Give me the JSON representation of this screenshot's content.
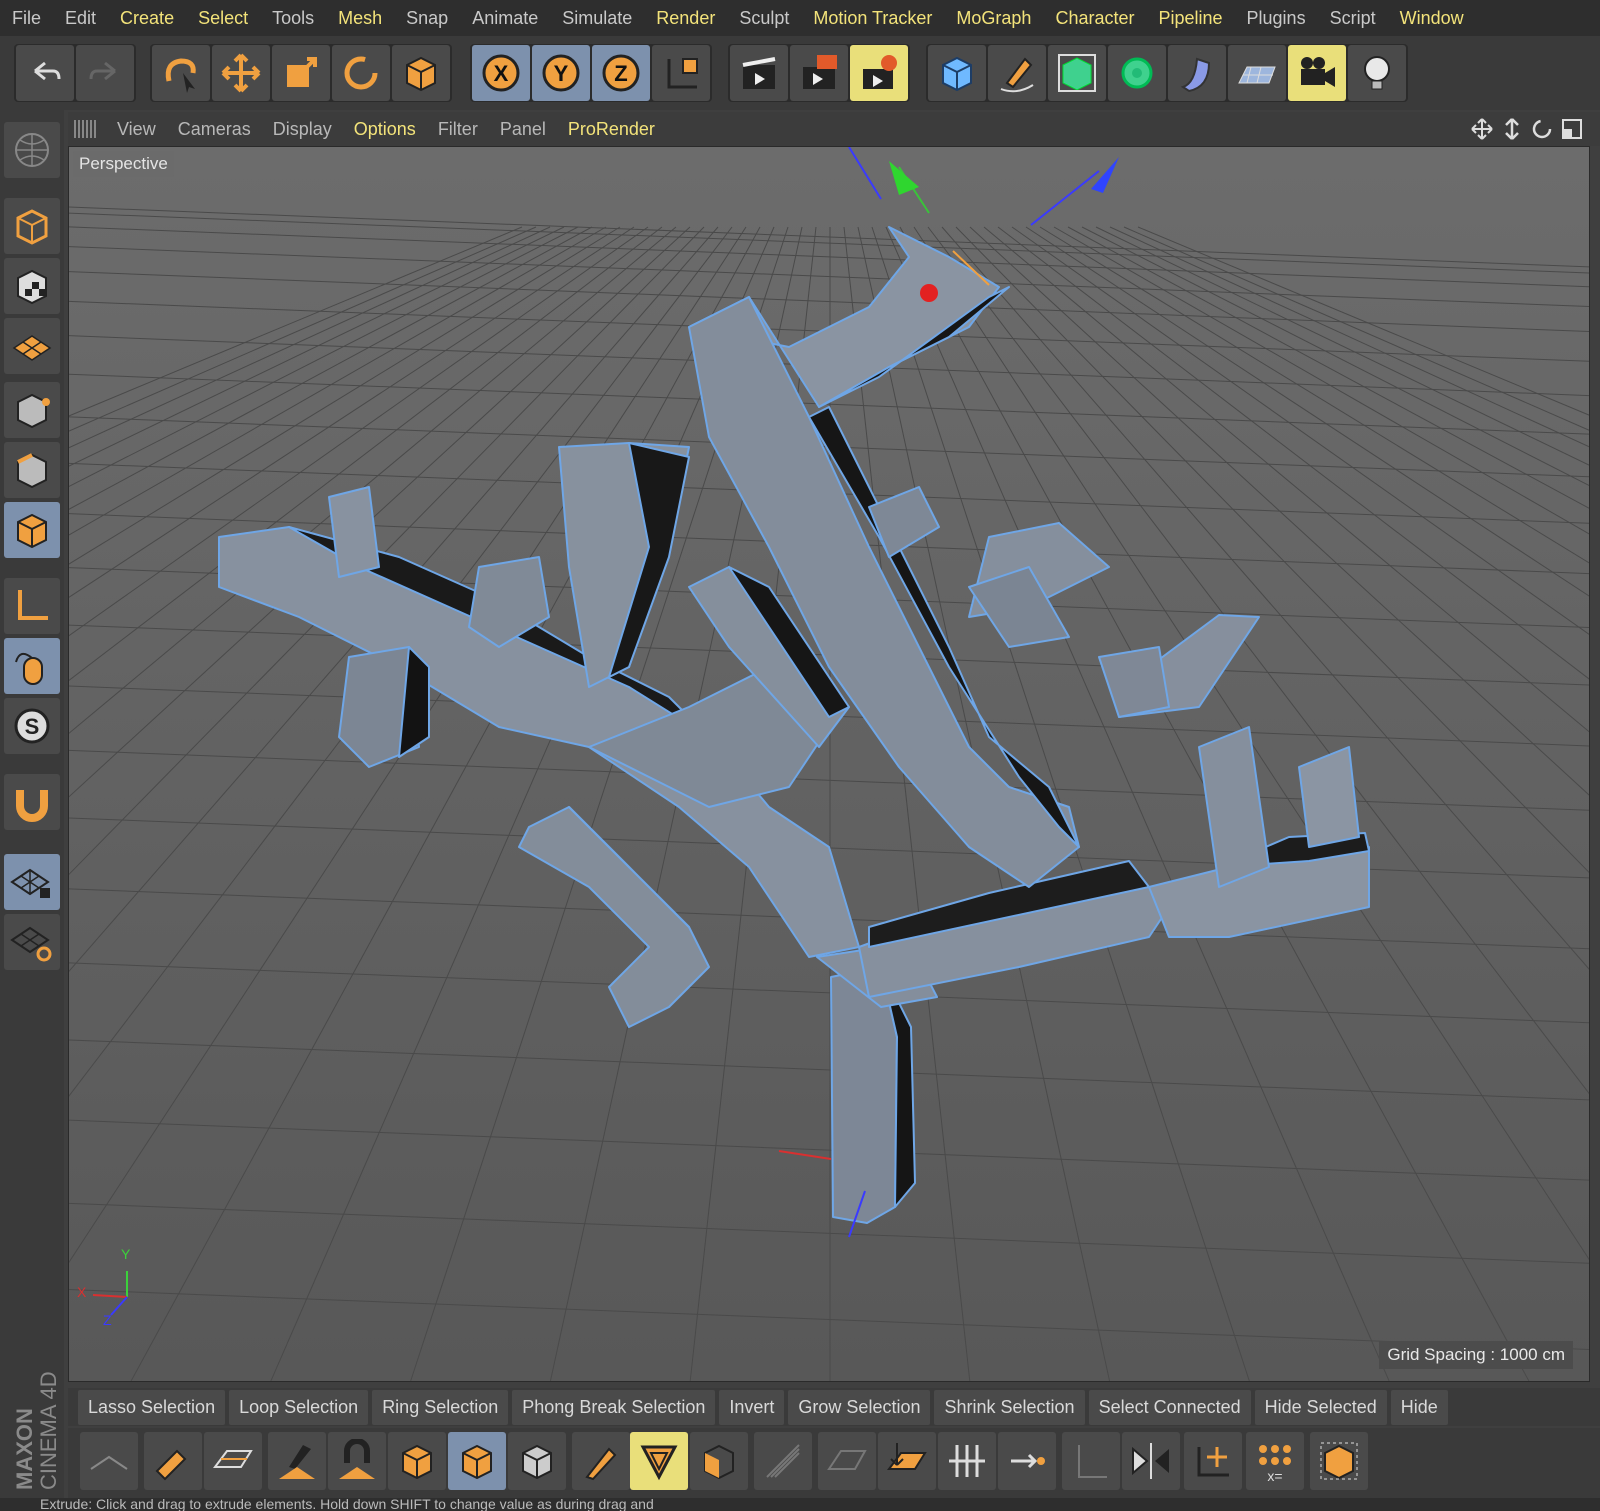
{
  "menu": [
    {
      "label": "File",
      "hl": false
    },
    {
      "label": "Edit",
      "hl": false
    },
    {
      "label": "Create",
      "hl": true
    },
    {
      "label": "Select",
      "hl": true
    },
    {
      "label": "Tools",
      "hl": false
    },
    {
      "label": "Mesh",
      "hl": true
    },
    {
      "label": "Snap",
      "hl": false
    },
    {
      "label": "Animate",
      "hl": false
    },
    {
      "label": "Simulate",
      "hl": false
    },
    {
      "label": "Render",
      "hl": true
    },
    {
      "label": "Sculpt",
      "hl": false
    },
    {
      "label": "Motion Tracker",
      "hl": true
    },
    {
      "label": "MoGraph",
      "hl": true
    },
    {
      "label": "Character",
      "hl": true
    },
    {
      "label": "Pipeline",
      "hl": true
    },
    {
      "label": "Plugins",
      "hl": false
    },
    {
      "label": "Script",
      "hl": false
    },
    {
      "label": "Window",
      "hl": true
    }
  ],
  "viewport_menu": [
    {
      "label": "View",
      "hl": false
    },
    {
      "label": "Cameras",
      "hl": false
    },
    {
      "label": "Display",
      "hl": false
    },
    {
      "label": "Options",
      "hl": true
    },
    {
      "label": "Filter",
      "hl": false
    },
    {
      "label": "Panel",
      "hl": false
    },
    {
      "label": "ProRender",
      "hl": true
    }
  ],
  "viewport": {
    "label": "Perspective",
    "grid_spacing": "Grid Spacing : 1000 cm",
    "axis": {
      "x": "X",
      "y": "Y",
      "z": "Z"
    }
  },
  "selection_bar": [
    "Lasso Selection",
    "Loop Selection",
    "Ring Selection",
    "Phong Break Selection",
    "Invert",
    "Grow Selection",
    "Shrink Selection",
    "Select Connected",
    "Hide Selected",
    "Hide"
  ],
  "toolbar_icons": {
    "undo": "undo-icon",
    "redo": "redo-icon",
    "live_select": "live-selection-icon",
    "move": "move-icon",
    "scale": "scale-icon",
    "rotate": "rotate-icon",
    "recent": "recent-object-icon",
    "x_axis": "x-axis-lock-icon",
    "y_axis": "y-axis-lock-icon",
    "z_axis": "z-axis-lock-icon",
    "coord": "coordinate-system-icon",
    "render_view": "render-view-icon",
    "render_pv": "render-picture-viewer-icon",
    "render_settings": "render-settings-icon",
    "cube": "cube-icon",
    "pen": "pen-icon",
    "subdivision": "subdivision-surface-icon",
    "cloner": "cloner-icon",
    "deformer": "bend-deformer-icon",
    "floor": "floor-icon",
    "camera": "camera-icon",
    "light": "light-icon"
  },
  "branding": {
    "brand": "MAXON",
    "product": "CINEMA 4D"
  },
  "status_text": "Extrude: Click and drag to extrude elements. Hold down SHIFT to change value as during drag and",
  "colors": {
    "highlight": "#f3e37a",
    "selected": "#7d91ad",
    "wire": "#6fa6e6"
  }
}
